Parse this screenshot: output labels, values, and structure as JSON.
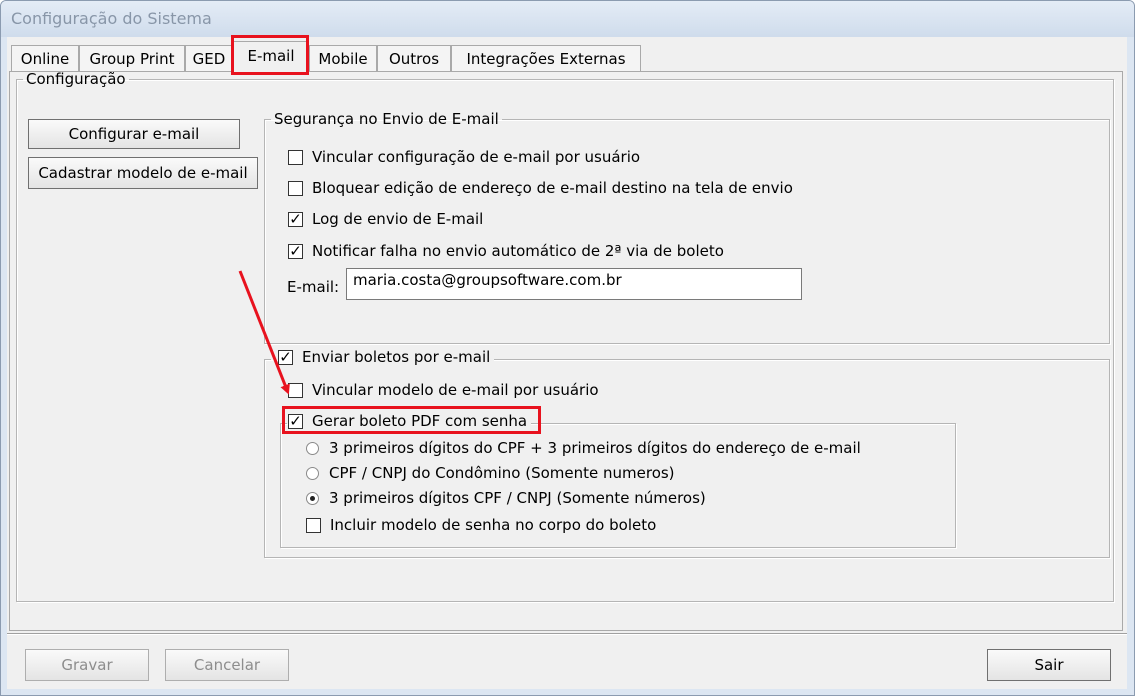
{
  "window": {
    "title": "Configuração do Sistema"
  },
  "tabs": [
    {
      "label": "Online"
    },
    {
      "label": "Group Print"
    },
    {
      "label": "GED"
    },
    {
      "label": "E-mail",
      "active": true
    },
    {
      "label": "Mobile"
    },
    {
      "label": "Outros"
    },
    {
      "label": "Integrações Externas"
    }
  ],
  "config": {
    "legend": "Configuração",
    "configure_button": "Configurar e-mail",
    "register_button": "Cadastrar modelo de e-mail"
  },
  "security": {
    "legend": "Segurança no Envio de E-mail",
    "options": [
      {
        "label": "Vincular configuração de e-mail por usuário",
        "checked": false
      },
      {
        "label": "Bloquear edição de endereço de e-mail destino na tela de envio",
        "checked": false
      },
      {
        "label": "Log de envio de E-mail",
        "checked": true
      },
      {
        "label": "Notificar falha no envio automático de 2ª via de boleto",
        "checked": true
      }
    ],
    "email_label": "E-mail:",
    "email_value": "maria.costa@groupsoftware.com.br"
  },
  "boletos": {
    "legend": "Enviar boletos por e-mail",
    "checked": true,
    "link_model": {
      "label": "Vincular modelo de e-mail por usuário",
      "checked": false
    },
    "pdf_password": {
      "label": "Gerar boleto PDF com senha",
      "checked": true,
      "options": [
        {
          "label": "3 primeiros dígitos do CPF + 3 primeiros dígitos do endereço de e-mail",
          "selected": false
        },
        {
          "label": "CPF / CNPJ do Condômino (Somente numeros)",
          "selected": false
        },
        {
          "label": "3 primeiros dígitos CPF / CNPJ (Somente números)",
          "selected": true
        }
      ],
      "include_model": {
        "label": "Incluir modelo de senha no corpo do boleto",
        "checked": false
      }
    }
  },
  "footer": {
    "save": "Gravar",
    "cancel": "Cancelar",
    "exit": "Sair"
  },
  "colors": {
    "highlight": "#e8121e",
    "title_text": "#8896a8"
  }
}
